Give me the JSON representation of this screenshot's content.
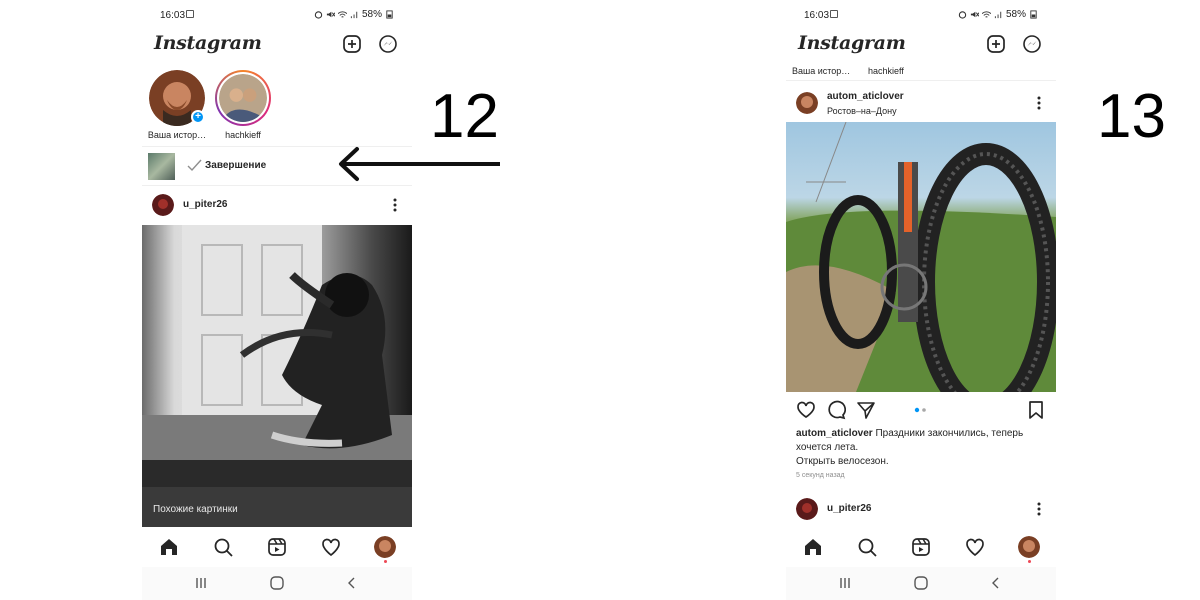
{
  "steps": {
    "left": "12",
    "right": "13"
  },
  "status_bar": {
    "time": "16:03",
    "battery": "58%"
  },
  "app": {
    "logo": "Instagram"
  },
  "left_screen": {
    "stories": [
      {
        "label": "Ваша истор…",
        "avatar": "own-avatar"
      },
      {
        "label": "hachkieff",
        "avatar": "friend-avatar"
      }
    ],
    "upload": {
      "status": "Завершение"
    },
    "post": {
      "username": "u_piter26"
    },
    "similar_label": "Похожие картинки"
  },
  "right_screen": {
    "stories_clipped": [
      "Ваша истор…",
      "hachkieff"
    ],
    "post": {
      "username": "autom_aticlover",
      "location": "Ростов–на–Дону",
      "caption_user": "autom_aticlover",
      "caption_line1": " Праздники закончились, теперь",
      "caption_line2": "хочется лета.",
      "caption_line3": "Открыть велосезон.",
      "time_ago": "5 секунд назад",
      "carousel": {
        "current": 1,
        "total": 2
      }
    },
    "next_post": {
      "username": "u_piter26"
    }
  },
  "icons": {
    "header": [
      "add-post-icon",
      "messenger-icon"
    ],
    "nav": [
      "home-icon",
      "search-icon",
      "reels-icon",
      "heart-icon",
      "profile-avatar"
    ],
    "actions": [
      "like-icon",
      "comment-icon",
      "share-icon",
      "bookmark-icon"
    ],
    "system": [
      "recents-icon",
      "home-circle-icon",
      "back-icon"
    ]
  },
  "colors": {
    "accent_blue": "#0095f6",
    "notification_red": "#ed4956",
    "text": "#262626"
  }
}
